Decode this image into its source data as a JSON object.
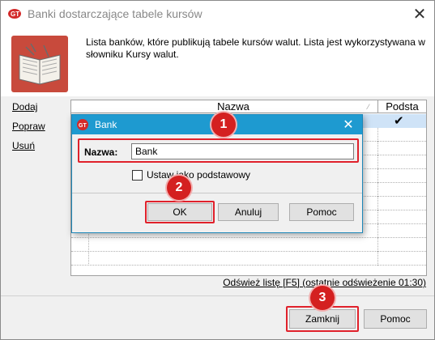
{
  "window": {
    "title": "Banki dostarczające tabele kursów",
    "close_label": "✕"
  },
  "header": {
    "description": "Lista banków, które publikują tabele kursów walut. Lista jest wykorzystywana w słowniku Kursy walut."
  },
  "side_actions": {
    "add": "Dodaj",
    "edit": "Popraw",
    "delete": "Usuń"
  },
  "grid": {
    "columns": [
      "Nazwa",
      "Podsta"
    ],
    "sort_indicator": "⁄",
    "selected_row_check": "✔"
  },
  "refresh_link": "Odśwież listę [F5] (ostatnie odświeżenie 01:30)",
  "footer": {
    "close_button": "Zamknij",
    "help_button": "Pomoc"
  },
  "dialog": {
    "title": "Bank",
    "close_label": "✕",
    "name_label": "Nazwa:",
    "name_value": "Bank",
    "checkbox_label": "Ustaw jako podstawowy",
    "checkbox_checked": false,
    "ok": "OK",
    "cancel": "Anuluj",
    "help": "Pomoc"
  },
  "badges": [
    "1",
    "2",
    "3"
  ],
  "colors": {
    "accent": "#1e9ad0",
    "highlight": "#e0212b",
    "badge": "#d42020",
    "selection": "#cfe3f7",
    "brand": "#c84a3c"
  },
  "icons": {
    "app": "app-logo-icon",
    "book": "open-book-icon",
    "close": "close-icon",
    "check": "checkmark-icon"
  }
}
